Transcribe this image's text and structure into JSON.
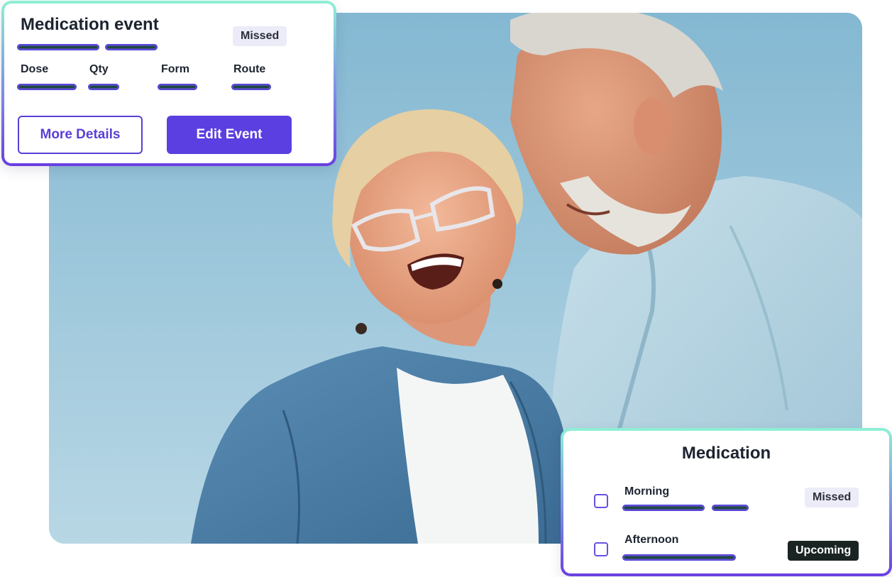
{
  "hero": {
    "image": "photo-senior-couple-laughing",
    "sky_color": "#8fbfd6"
  },
  "event_card": {
    "title": "Medication event",
    "status": "Missed",
    "fields": {
      "dose": "Dose",
      "qty": "Qty",
      "form": "Form",
      "route": "Route"
    },
    "buttons": {
      "more_details": "More Details",
      "edit_event": "Edit Event"
    }
  },
  "medication_card": {
    "title": "Medication",
    "slots": [
      {
        "label": "Morning",
        "status": "Missed"
      },
      {
        "label": "Afternoon",
        "status": "Upcoming"
      }
    ]
  },
  "colors": {
    "accent": "#5b3fe0",
    "border_gradient_top": "#8ef0d4",
    "border_gradient_bottom": "#6a3fe0",
    "placeholder_bar": "#1f4a44",
    "badge_missed_bg": "#ecebf8",
    "badge_upcoming_bg": "#1a2422"
  }
}
